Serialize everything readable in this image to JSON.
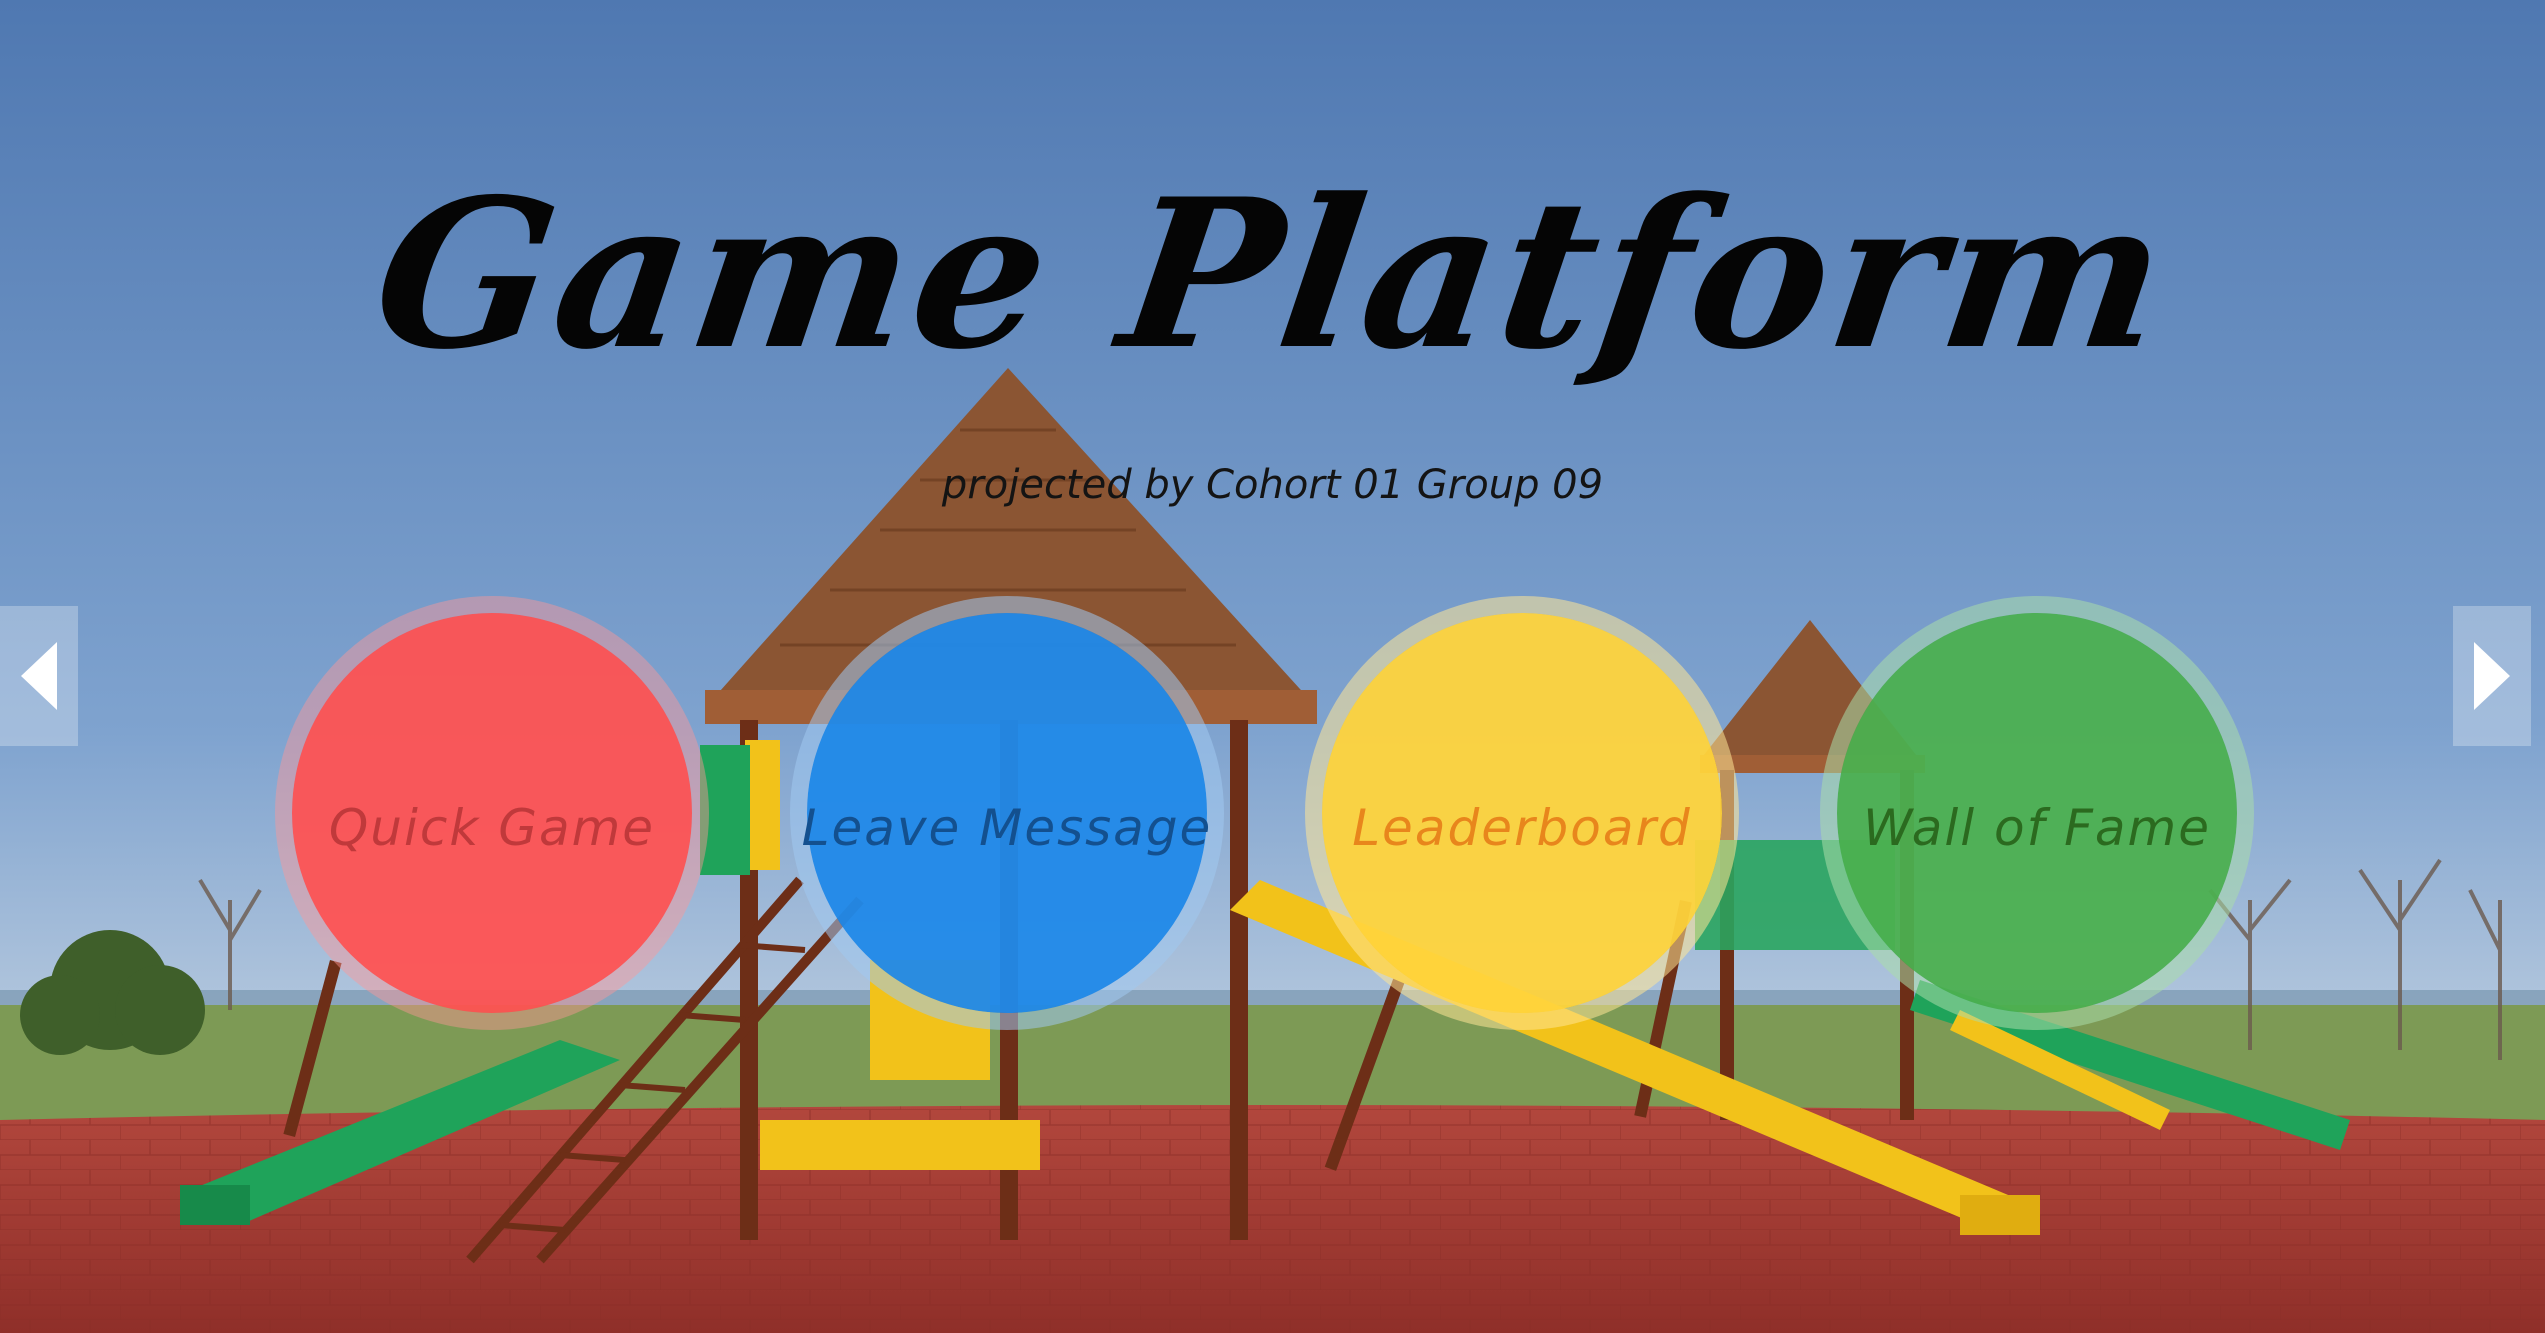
{
  "header": {
    "title": "Game Platform",
    "subtitle": "projected by Cohort 01 Group 09"
  },
  "menu": [
    {
      "label": "Quick Game",
      "color": "#ff5252",
      "text_color": "#c0393b"
    },
    {
      "label": "Leave Message",
      "color": "#2189e8",
      "text_color": "#13508f"
    },
    {
      "label": "Leaderboard",
      "color": "#ffd43c",
      "text_color": "#e8861c"
    },
    {
      "label": "Wall of Fame",
      "color": "#4cb050",
      "text_color": "#2b6a1f"
    }
  ],
  "navigation": {
    "prev_icon": "triangle-left-icon",
    "next_icon": "triangle-right-icon"
  },
  "background": {
    "scene": "playground-photo",
    "sky_color": "#5a86bd",
    "ground_color": "#a83c33"
  }
}
